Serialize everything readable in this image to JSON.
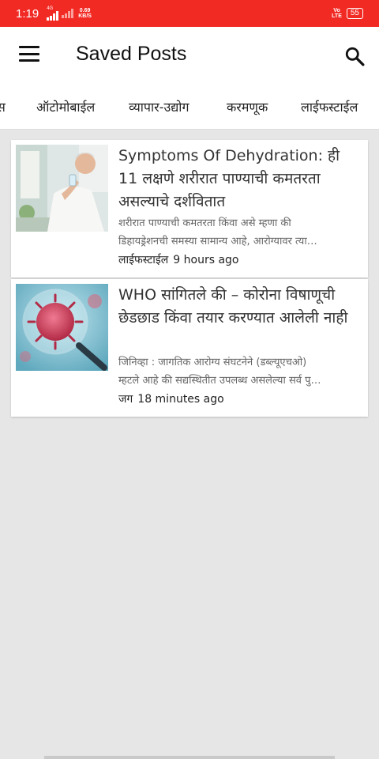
{
  "status_bar": {
    "time": "1:19",
    "network_label": "4G",
    "speed_value": "0.69",
    "speed_unit": "KB/S",
    "volte_line1": "Vo",
    "volte_line2": "LTE",
    "battery": "55"
  },
  "app_bar": {
    "title": "Saved Posts",
    "menu_icon": "menu-icon",
    "search_icon": "search-icon"
  },
  "tabs": [
    "स",
    "ऑटोमोबाईल",
    "व्यापार-उद्योग",
    "करमणूक",
    "लाईफस्टाईल"
  ],
  "posts": [
    {
      "title": "Symptoms Of Dehydration: ही 11 लक्षणे शरीरात पाण्याची कमतरता असल्याचे दर्शवितात",
      "excerpt_line1": "शरीरात पाण्याची कमतरता किंवा असे म्हणा की",
      "excerpt_line2": "डिहायड्रेशनची समस्या सामान्य आहे, आरोग्यावर त्या…",
      "category": "लाईफस्टाईल",
      "time": "9 hours ago"
    },
    {
      "title": "WHO सांगितले की – कोरोना विषाणूची छेडछाड किंवा तयार करण्यात आलेली नाही",
      "excerpt_line1": "जिनिव्हा : जागतिक आरोग्य संघटनेने (डब्ल्यूएचओ)",
      "excerpt_line2": "म्हटले आहे की सद्यस्थितीत उपलब्ध असलेल्या सर्व पु…",
      "category": "जग",
      "time": "18 minutes ago"
    }
  ]
}
